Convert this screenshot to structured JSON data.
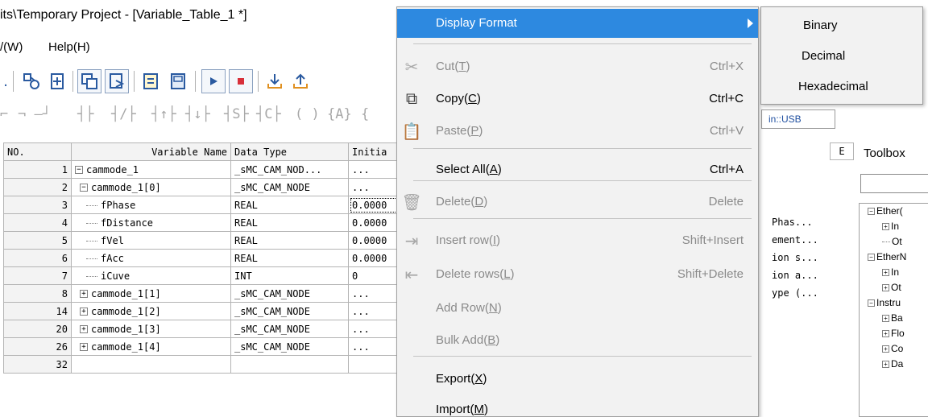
{
  "window": {
    "title": "its\\Temporary Project - [Variable_Table_1 *]"
  },
  "menubar": {
    "items": [
      "/(W)",
      "Help(H)"
    ]
  },
  "toolbar1": {
    "buttons": [
      "project-icon",
      "watch-icon",
      "add-variable-icon",
      "copy-window-icon",
      "paste-window-icon",
      "save-icon",
      "save-all-icon",
      "run-icon",
      "stop-icon",
      "download-icon",
      "upload-icon"
    ]
  },
  "ladder_toolbar": {
    "symbols": [
      "⌐",
      "¬ —┘",
      "┤├",
      "┤/├",
      "┤↑├",
      "┤↓├",
      "┤S├",
      "┤C├",
      "( )",
      "{A}",
      "{"
    ]
  },
  "variable_table": {
    "headers": [
      "NO.",
      "Variable Name",
      "Data Type",
      "Initia"
    ],
    "rows": [
      {
        "no": "1",
        "name": "cammode_1",
        "type": "_sMC_CAM_NOD...",
        "init": "...",
        "tree": "minus",
        "indent": 0
      },
      {
        "no": "2",
        "name": "cammode_1[0]",
        "type": "_sMC_CAM_NODE",
        "init": "...",
        "tree": "minus",
        "indent": 1
      },
      {
        "no": "3",
        "name": "fPhase",
        "type": "REAL",
        "init": "0.0000",
        "tree": "line",
        "indent": 2
      },
      {
        "no": "4",
        "name": "fDistance",
        "type": "REAL",
        "init": "0.0000",
        "tree": "line",
        "indent": 2
      },
      {
        "no": "5",
        "name": "fVel",
        "type": "REAL",
        "init": "0.0000",
        "tree": "line",
        "indent": 2
      },
      {
        "no": "6",
        "name": "fAcc",
        "type": "REAL",
        "init": "0.0000",
        "tree": "line",
        "indent": 2
      },
      {
        "no": "7",
        "name": "iCuve",
        "type": "INT",
        "init": "0",
        "tree": "line",
        "indent": 2
      },
      {
        "no": "8",
        "name": "cammode_1[1]",
        "type": "_sMC_CAM_NODE",
        "init": "...",
        "tree": "plus",
        "indent": 1
      },
      {
        "no": "14",
        "name": "cammode_1[2]",
        "type": "_sMC_CAM_NODE",
        "init": "...",
        "tree": "plus",
        "indent": 1
      },
      {
        "no": "20",
        "name": "cammode_1[3]",
        "type": "_sMC_CAM_NODE",
        "init": "...",
        "tree": "plus",
        "indent": 1
      },
      {
        "no": "26",
        "name": "cammode_1[4]",
        "type": "_sMC_CAM_NODE",
        "init": "...",
        "tree": "plus",
        "indent": 1
      },
      {
        "no": "32",
        "name": "",
        "type": "",
        "init": "",
        "tree": "none",
        "indent": 0
      }
    ]
  },
  "right_panel": {
    "connection_tab": "in::USB",
    "column_header": "E",
    "comments": [
      "",
      "",
      "",
      "Phas...",
      "ement...",
      "ion s...",
      "ion a...",
      "ype (..."
    ]
  },
  "toolbox": {
    "title": "Toolbox",
    "tree": [
      {
        "label": "Ether(",
        "expander": "minus",
        "indent": 0
      },
      {
        "label": "In",
        "expander": "plus",
        "indent": 1
      },
      {
        "label": "Ot",
        "expander": "line",
        "indent": 1
      },
      {
        "label": "EtherN",
        "expander": "minus",
        "indent": 0
      },
      {
        "label": "In",
        "expander": "plus",
        "indent": 1
      },
      {
        "label": "Ot",
        "expander": "plus",
        "indent": 1
      },
      {
        "label": "Instru",
        "expander": "minus",
        "indent": 0
      },
      {
        "label": "Ba",
        "expander": "plus",
        "indent": 1
      },
      {
        "label": "Flo",
        "expander": "plus",
        "indent": 1
      },
      {
        "label": "Co",
        "expander": "plus",
        "indent": 1
      },
      {
        "label": "Da",
        "expander": "plus",
        "indent": 1
      }
    ]
  },
  "context_menu": {
    "highlight_color": "#2d89e0",
    "items": [
      {
        "label": "Display Format",
        "underline": "",
        "shortcut": "",
        "icon": "",
        "disabled": false,
        "highlight": true,
        "submenu": true
      },
      {
        "label": "Cut(",
        "underline": "T",
        "suffix": ")",
        "shortcut": "Ctrl+X",
        "icon": "scissors-icon",
        "disabled": true
      },
      {
        "label": "Copy(",
        "underline": "C",
        "suffix": ")",
        "shortcut": "Ctrl+C",
        "icon": "copy-icon",
        "disabled": false
      },
      {
        "label": "Paste(",
        "underline": "P",
        "suffix": ")",
        "shortcut": "Ctrl+V",
        "icon": "paste-icon",
        "disabled": true
      },
      {
        "label": "Select All(",
        "underline": "A",
        "suffix": ")",
        "shortcut": "Ctrl+A",
        "icon": "",
        "disabled": false
      },
      {
        "label": "Delete(",
        "underline": "D",
        "suffix": ")",
        "shortcut": "Delete",
        "icon": "trash-icon",
        "disabled": true
      },
      {
        "label": "Insert row(",
        "underline": "I",
        "suffix": ")",
        "shortcut": "Shift+Insert",
        "icon": "insert-row-icon",
        "disabled": true
      },
      {
        "label": "Delete rows(",
        "underline": "L",
        "suffix": ")",
        "shortcut": "Shift+Delete",
        "icon": "delete-rows-icon",
        "disabled": true
      },
      {
        "label": "Add Row(",
        "underline": "N",
        "suffix": ")",
        "shortcut": "",
        "icon": "",
        "disabled": true
      },
      {
        "label": "Bulk Add(",
        "underline": "B",
        "suffix": ")",
        "shortcut": "",
        "icon": "",
        "disabled": true
      },
      {
        "label": "Export(",
        "underline": "X",
        "suffix": ")",
        "shortcut": "",
        "icon": "",
        "disabled": false
      },
      {
        "label": "Import(",
        "underline": "M",
        "suffix": ")",
        "shortcut": "",
        "icon": "",
        "disabled": false
      }
    ]
  },
  "submenu": {
    "items": [
      "Binary",
      "Decimal",
      "Hexadecimal"
    ]
  }
}
